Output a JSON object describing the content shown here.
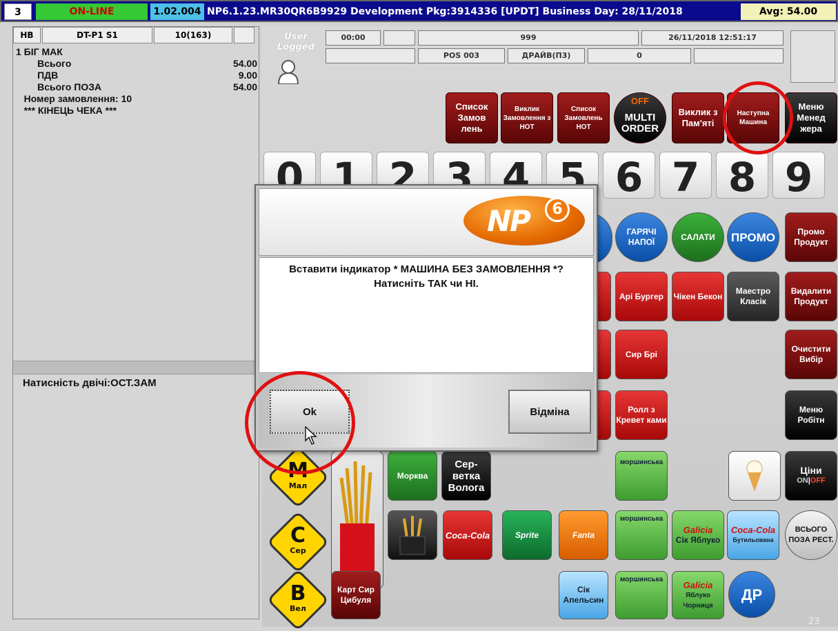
{
  "topbar": {
    "terminal_no": "3",
    "status": "ON-LINE",
    "version": "1.02.004",
    "info": "NP6.1.23.MR30QR6B9929 Development Pkg:3914336  [UPDT] Business Day: 28/11/2018",
    "avg": "Avg: 54.00"
  },
  "receipt": {
    "header": [
      "HB",
      "DT-P1 S1",
      "10(163)",
      ""
    ],
    "lines": [
      {
        "text": "1 БІГ МАК",
        "amount": ""
      },
      {
        "text": "        Всього",
        "amount": "54.00"
      },
      {
        "text": "        ПДВ",
        "amount": "9.00"
      },
      {
        "text": "        Всього ПОЗА",
        "amount": "54.00"
      },
      {
        "text": "   Номер замовлення: 10",
        "amount": ""
      },
      {
        "text": "   *** КІНЕЦЬ ЧЕКА ***",
        "amount": ""
      }
    ],
    "hint": "Натисність двічі:ОСТ.ЗАМ"
  },
  "user": {
    "line1": "User",
    "line2": "Logged"
  },
  "info_cells": {
    "time": "00:00",
    "code": "999",
    "datetime": "26/11/2018 12:51:17",
    "pos": "POS 003",
    "mode": "ДРАЙВ(П3)",
    "count": "0"
  },
  "function_buttons": [
    "Список Замов лень",
    "Виклик Замовлення з HOT",
    "Список Замовлень HOT",
    "MULTI ORDER",
    "Виклик з Пам'яті",
    "Наступна Машина",
    "Меню Менед жера"
  ],
  "multi_off": "OFF",
  "digits": [
    "0",
    "1",
    "2",
    "3",
    "4",
    "5",
    "6",
    "7",
    "8",
    "9"
  ],
  "categories": {
    "hot_drinks": "ГАРЯЧІ НАПОЇ",
    "salads": "САЛАТИ",
    "promo": "ПРОМО",
    "promo_product": "Промо Продукт"
  },
  "items": {
    "apple_burger": "Арі Бургер",
    "chicken_bacon": "Чікен Бекон",
    "maestro": "Маестро Класік",
    "delete_product": "Видалити Продукт",
    "brie": "Сир Брі",
    "clear_selection": "Очистити Вибір",
    "shrimp_roll": "Ролл з Кревет ками",
    "staff_menu": "Меню Робітн",
    "morshynska": "моршинська",
    "prices": "Ціни",
    "prices_on": "ON",
    "prices_off": "OFF",
    "carrot": "Морква",
    "napkin": "Сер- ветка Волога",
    "coca_cola": "Coca-Cola",
    "sprite": "Sprite",
    "fanta": "Fanta",
    "galicia_apple": "Сік Яблуко",
    "coca_bottle": "Бутильована",
    "total_rest": "ВСЬОГО ПОЗА РЕСТ.",
    "potato_cheese": "Карт Сир Цибуля",
    "juice_orange": "Сік Апельсин",
    "galicia_berry": "Яблуко Чорниця",
    "dr": "ДР",
    "galicia": "Galicia"
  },
  "sizes": [
    {
      "letter": "M",
      "sub": "Мал"
    },
    {
      "letter": "C",
      "sub": "Сер"
    },
    {
      "letter": "B",
      "sub": "Вел"
    }
  ],
  "modal": {
    "logo": "NP",
    "logo_sup": "6",
    "message": "Вставити індикатор * МАШИНА БЕЗ ЗАМОВЛЕННЯ *? Натисніть ТАК чи НІ.",
    "ok": "Ok",
    "cancel": "Відміна"
  },
  "slide_number": "23",
  "colors": {
    "annotation": "#e01010",
    "topbar_bg": "#0a0a8c",
    "online_bg": "#35c935",
    "maroon": "#7a0e0e"
  }
}
